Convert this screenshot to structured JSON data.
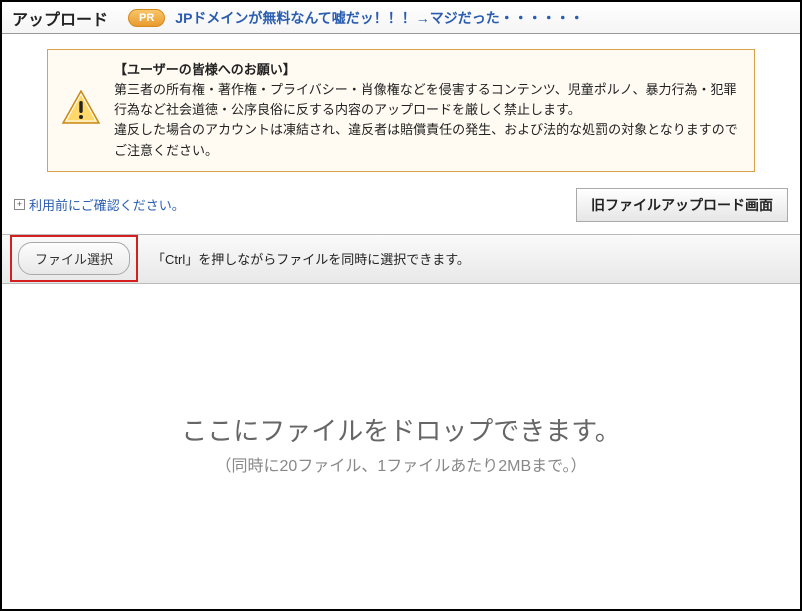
{
  "header": {
    "title": "アップロード",
    "pr_badge": "PR",
    "pr_text": "JPドメインが無料なんて嘘だッ！！！→マジだった・・・・・・"
  },
  "notice": {
    "title": "【ユーザーの皆様へのお願い】",
    "line1": "第三者の所有権・著作権・プライバシー・肖像権などを侵害するコンテンツ、児童ポルノ、暴力行為・犯罪行為など社会道徳・公序良俗に反する内容のアップロードを厳しく禁止します。",
    "line2": "違反した場合のアカウントは凍結され、違反者は賠償責任の発生、および法的な処罰の対象となりますのでご注意ください。"
  },
  "midrow": {
    "confirm_link": "利用前にご確認ください。",
    "old_upload_btn": "旧ファイルアップロード画面"
  },
  "filebar": {
    "select_btn": "ファイル選択",
    "hint": "「Ctrl」を押しながらファイルを同時に選択できます。"
  },
  "dropzone": {
    "main": "ここにファイルをドロップできます。",
    "sub": "（同時に20ファイル、1ファイルあたり2MBまで。）"
  }
}
